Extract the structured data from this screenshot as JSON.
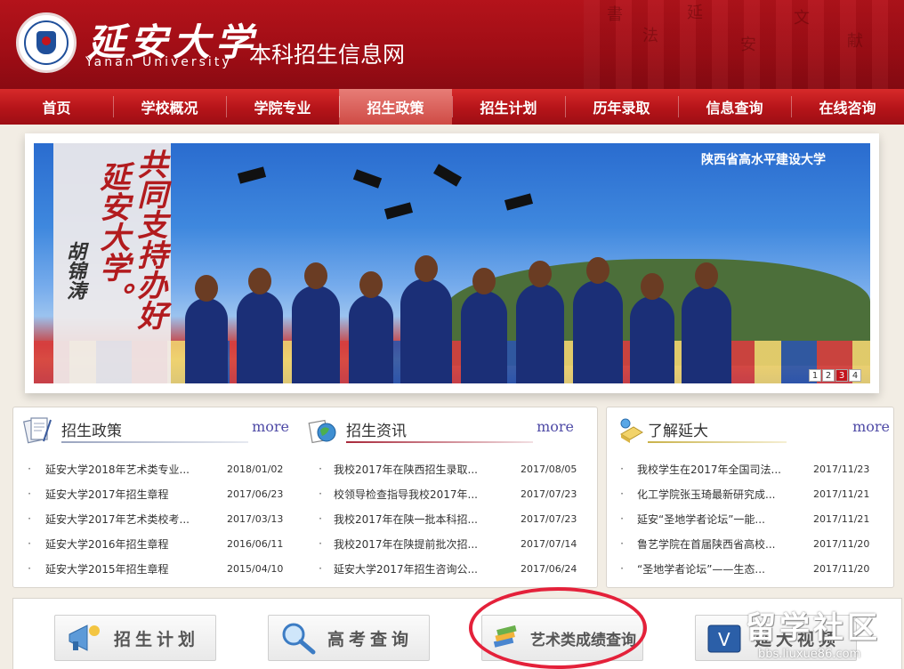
{
  "header": {
    "logo_name": "延安大学",
    "logo_english": "Yanan University",
    "site_name": "本科招生信息网"
  },
  "nav": {
    "items": [
      "首页",
      "学校概况",
      "学院专业",
      "招生政策",
      "招生计划",
      "历年录取",
      "信息查询",
      "在线咨询"
    ],
    "active_index": 3
  },
  "banner": {
    "poem_col1": "共同支持办好",
    "poem_col2": "延安大学。",
    "poem_sign": "胡锦涛",
    "tagline": "陕西省高水平建设大学",
    "pager": [
      "1",
      "2",
      "3",
      "4"
    ],
    "pager_active": "3"
  },
  "panels": {
    "policy": {
      "title": "招生政策",
      "more": "more",
      "items": [
        {
          "title": "延安大学2018年艺术类专业...",
          "date": "2018/01/02"
        },
        {
          "title": "延安大学2017年招生章程",
          "date": "2017/06/23"
        },
        {
          "title": "延安大学2017年艺术类校考...",
          "date": "2017/03/13"
        },
        {
          "title": "延安大学2016年招生章程",
          "date": "2016/06/11"
        },
        {
          "title": "延安大学2015年招生章程",
          "date": "2015/04/10"
        }
      ]
    },
    "news": {
      "title": "招生资讯",
      "more": "more",
      "items": [
        {
          "title": "我校2017年在陕西招生录取...",
          "date": "2017/08/05"
        },
        {
          "title": "校领导检查指导我校2017年...",
          "date": "2017/07/23"
        },
        {
          "title": "我校2017年在陕一批本科招...",
          "date": "2017/07/23"
        },
        {
          "title": "我校2017年在陕提前批次招...",
          "date": "2017/07/14"
        },
        {
          "title": "延安大学2017年招生咨询公...",
          "date": "2017/06/24"
        }
      ]
    },
    "about": {
      "title": "了解延大",
      "more": "more",
      "items": [
        {
          "title": "我校学生在2017年全国司法...",
          "date": "2017/11/23"
        },
        {
          "title": "化工学院张玉琦最新研究成...",
          "date": "2017/11/21"
        },
        {
          "title": "延安“圣地学者论坛”一能...",
          "date": "2017/11/21"
        },
        {
          "title": "鲁艺学院在首届陕西省高校...",
          "date": "2017/11/20"
        },
        {
          "title": "“圣地学者论坛”——生态...",
          "date": "2017/11/20"
        }
      ]
    }
  },
  "quick": {
    "plan": "招生计划",
    "gaokao": "高考查询",
    "art": "艺术类成绩查询",
    "video": "延大视频"
  },
  "watermark": {
    "cn": "留学社区",
    "url": "bbs.liuxue86.com"
  },
  "colors": {
    "brand_red": "#b4131b",
    "more_link": "#4e4aa6",
    "highlight_oval": "#e4213a"
  }
}
